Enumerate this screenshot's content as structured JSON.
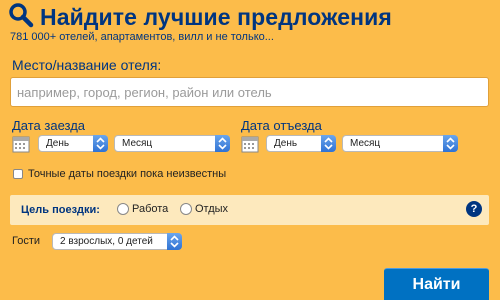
{
  "header": {
    "title": "Найдите лучшие предложения",
    "subtitle": "781 000+ отелей, апартаментов, вилл и не только..."
  },
  "destination": {
    "label": "Место/название отеля:",
    "placeholder": "например, город, регион, район или отель"
  },
  "checkin": {
    "label": "Дата заезда",
    "day": "День",
    "month": "Месяц"
  },
  "checkout": {
    "label": "Дата отъезда",
    "day": "День",
    "month": "Месяц"
  },
  "flexible_dates": {
    "label": "Точные даты поездки пока неизвестны",
    "checked": false
  },
  "trip_purpose": {
    "label": "Цель поездки:",
    "options": [
      "Работа",
      "Отдых"
    ],
    "help": "?"
  },
  "guests": {
    "label": "Гости",
    "value": "2 взрослых, 0 детей"
  },
  "search_button": "Найти",
  "colors": {
    "background": "#fcbc4a",
    "brand": "#003580",
    "button": "#0071c2"
  }
}
